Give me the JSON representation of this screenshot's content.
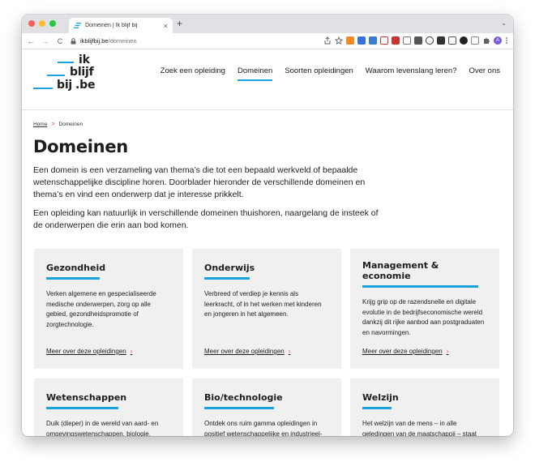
{
  "browser": {
    "tab_title": "Domeinen | Ik blijf bij",
    "tab_close": "×",
    "new_tab": "+",
    "tab_menu": "⌄",
    "back": "←",
    "forward": "→",
    "reload": "C",
    "lock": "🔒",
    "url_host": "ikblijfbij.be",
    "url_path": "/domeinen",
    "avatar_letter": "A"
  },
  "logo": {
    "word1": "ik",
    "word2": "blijf",
    "word3": "bij",
    "word4": ".be"
  },
  "nav": [
    {
      "label": "Zoek een opleiding"
    },
    {
      "label": "Domeinen"
    },
    {
      "label": "Soorten opleidingen"
    },
    {
      "label": "Waarom levenslang leren?"
    },
    {
      "label": "Over ons"
    }
  ],
  "breadcrumb": {
    "home": "Home",
    "sep": ">",
    "current": "Domeinen"
  },
  "page": {
    "title": "Domeinen",
    "intro1": "Een domein is een verzameling van thema’s die tot een bepaald werkveld of bepaalde wetenschappelijke discipline horen. Doorblader hieronder de verschillende domeinen en thema’s en vind een onderwerp dat je interesse prikkelt.",
    "intro2": "Een opleiding kan natuurlijk in verschillende domeinen thuishoren, naargelang de insteek of de onderwerpen die erin aan bod komen."
  },
  "cards": [
    {
      "title": "Gezondheid",
      "text": "Verken algemene en gespecialiseerde medische onderwerpen, zorg op alle gebied, gezondheidspromotie of zorgtechnologie.",
      "link": "Meer over deze opleidingen",
      "chev": "›"
    },
    {
      "title": "Onderwijs",
      "text": "Verbreed of verdiep je kennis als leerkracht, of in het werken met kinderen en jongeren in het algemeen.",
      "link": "Meer over deze opleidingen",
      "chev": "›"
    },
    {
      "title": "Management & economie",
      "text": "Krijg grip op de razendsnelle en digitale evolutie in de bedrijfseconomische wereld dankzij dit rijke aanbod aan postgraduaten en navormingen.",
      "link": "Meer over deze opleidingen",
      "chev": "›"
    },
    {
      "title": "Wetenschappen",
      "text": "Duik (dieper) in de wereld van aard- en omgevingswetenschappen, biologie, chemie, natuurkunde,",
      "link": "",
      "chev": ""
    },
    {
      "title": "Bio/technologie",
      "text": "Ontdek ons ruim gamma opleidingen in positief wetenschappelijke en industrieel-technische onderwerpen,",
      "link": "",
      "chev": ""
    },
    {
      "title": "Welzijn",
      "text": "Het welzijn van de mens – in alle geledingen van de maatschappij – staat centraal in deze brede set aan",
      "link": "",
      "chev": ""
    }
  ],
  "colors": {
    "accent": "#1aa3df",
    "chevron": "#e53974",
    "card_bg": "#f0f0f0"
  }
}
